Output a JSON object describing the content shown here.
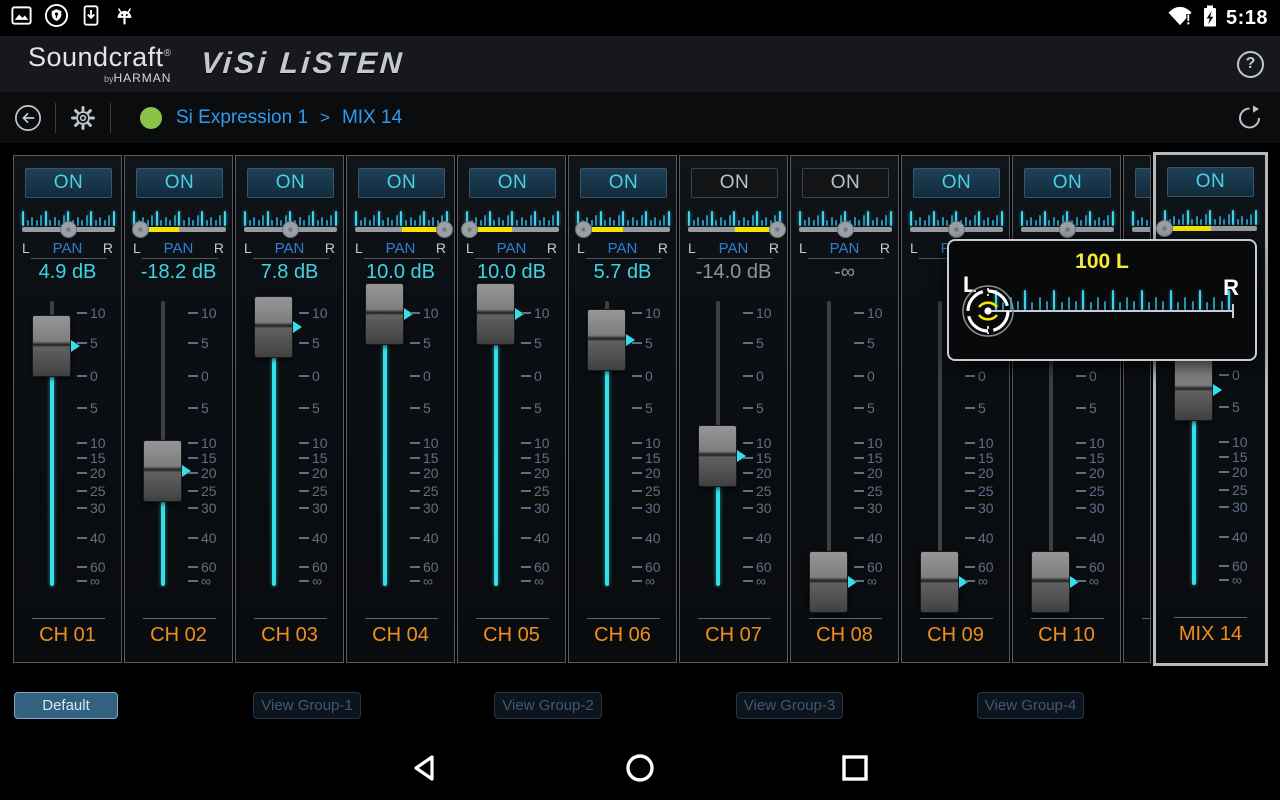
{
  "status_bar": {
    "time": "5:18",
    "left_icons": [
      "screenshot-icon",
      "shield-circle-icon",
      "download-icon",
      "android-icon"
    ],
    "right_icons": [
      "wifi-alert-icon",
      "battery-charging-icon"
    ]
  },
  "header": {
    "brand": "Soundcraft",
    "registered": "®",
    "by": "by",
    "harman": "HARMAN",
    "app_title": "ViSi LiSTEN",
    "help_label": "?"
  },
  "breadcrumb": {
    "device": "Si Expression 1",
    "separator": ">",
    "target": "MIX 14",
    "connection_status_color": "#8bc34a"
  },
  "mixer": {
    "on_label": "ON",
    "pan_label": "PAN",
    "left_label": "L",
    "right_label": "R",
    "fader_scale": [
      "10",
      "5",
      "0",
      "5",
      "10",
      "15",
      "20",
      "25",
      "30",
      "40",
      "60",
      "∞"
    ],
    "channels": [
      {
        "label": "CH 01",
        "on": true,
        "db": "4.9 dB",
        "pan_pct": 50,
        "fader_pct": 15.8
      },
      {
        "label": "CH 02",
        "on": true,
        "db": "-18.2 dB",
        "pan_pct": 8,
        "fader_pct": 59.6
      },
      {
        "label": "CH 03",
        "on": true,
        "db": "7.8 dB",
        "pan_pct": 50,
        "fader_pct": 9.1
      },
      {
        "label": "CH 04",
        "on": true,
        "db": "10.0 dB",
        "pan_pct": 96,
        "fader_pct": 4.6
      },
      {
        "label": "CH 05",
        "on": true,
        "db": "10.0 dB",
        "pan_pct": 4,
        "fader_pct": 4.6
      },
      {
        "label": "CH 06",
        "on": true,
        "db": "5.7 dB",
        "pan_pct": 7,
        "fader_pct": 13.7
      },
      {
        "label": "CH 07",
        "on": false,
        "db": "-14.0 dB",
        "pan_pct": 96,
        "fader_pct": 54.4
      },
      {
        "label": "CH 08",
        "on": false,
        "db": "-∞",
        "pan_pct": 50,
        "fader_pct": 98.6
      },
      {
        "label": "CH 09",
        "on": true,
        "db": null,
        "pan_pct": 50,
        "fader_pct": 98.6
      },
      {
        "label": "CH 10",
        "on": true,
        "db": null,
        "pan_pct": 50,
        "fader_pct": 98.6
      },
      {
        "label": "",
        "on": true,
        "db": null,
        "pan_pct": 50,
        "fader_pct": null,
        "clipped": true
      },
      {
        "label": "MIX 14",
        "on": true,
        "db": null,
        "pan_pct": 0,
        "fader_pct": 31.6,
        "selected": true
      }
    ]
  },
  "pan_popup": {
    "value": "100 L",
    "left_label": "L",
    "right_label": "R",
    "value_color": "#f7ea3a"
  },
  "view_buttons": [
    {
      "label": "Default",
      "active": true
    },
    {
      "label": "View Group-1",
      "active": false
    },
    {
      "label": "View Group-2",
      "active": false
    },
    {
      "label": "View Group-3",
      "active": false
    },
    {
      "label": "View Group-4",
      "active": false
    }
  ],
  "nav_bar": {
    "icons": [
      "back-icon",
      "home-icon",
      "recents-icon"
    ]
  },
  "colors": {
    "accent_cyan": "#3bd6e6",
    "fader_cyan": "#35dfe9",
    "pan_yellow": "#f5e400",
    "channel_orange": "#ef8f1f",
    "link_blue": "#2e9bf0",
    "online_green": "#8bc34a"
  }
}
